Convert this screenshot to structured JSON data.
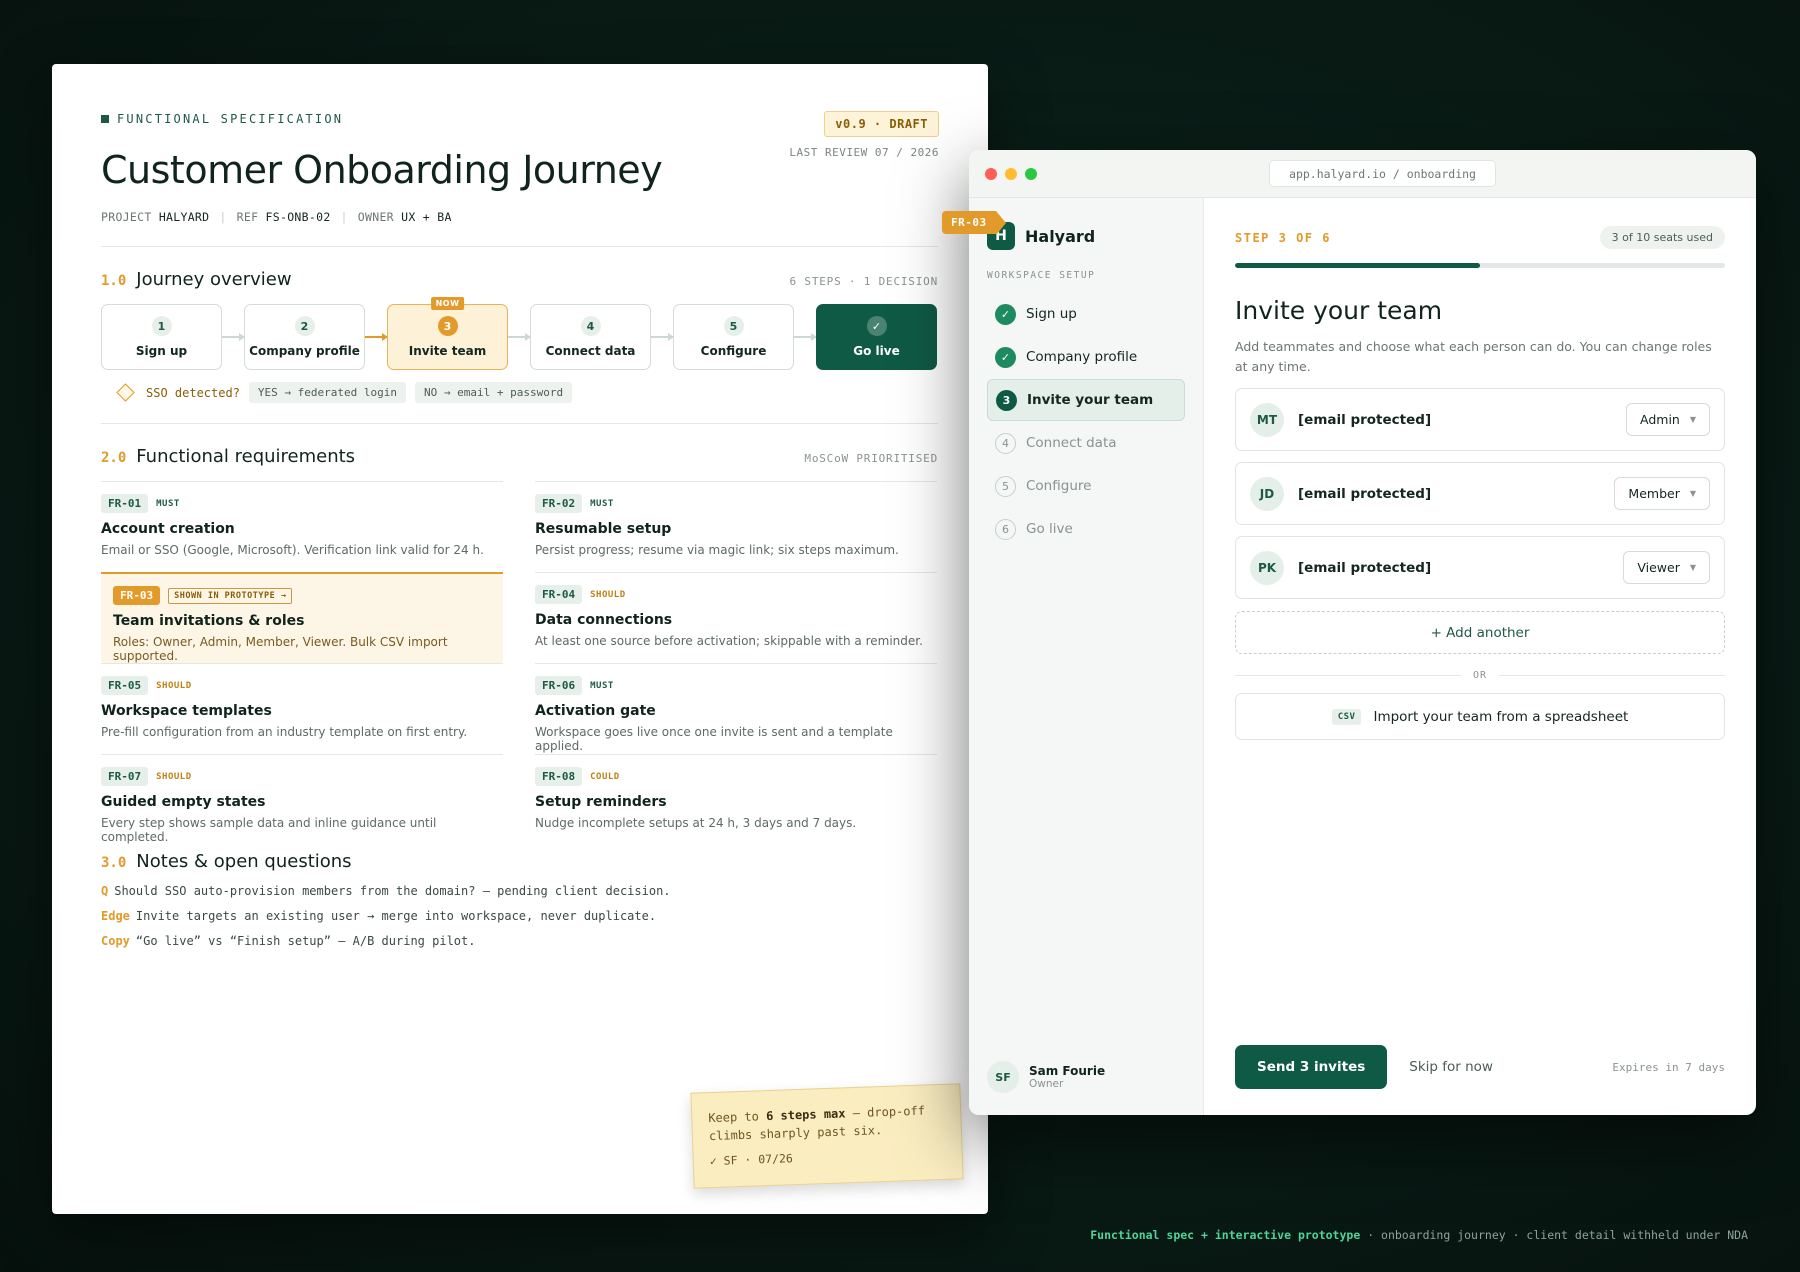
{
  "spec": {
    "eyebrow": "FUNCTIONAL SPECIFICATION",
    "version": "v0.9 · DRAFT",
    "last_review": "LAST REVIEW 07 / 2026",
    "title": "Customer Onboarding Journey",
    "meta": {
      "project_label": "PROJECT",
      "project_value": "HALYARD",
      "ref_label": "REF",
      "ref_value": "FS-ONB-02",
      "owner_label": "OWNER",
      "owner_value": "UX + BA"
    },
    "overview": {
      "num": "1.0",
      "title": "Journey overview",
      "summary": "6 STEPS · 1 DECISION",
      "now_label": "NOW",
      "steps": [
        {
          "marker": "1",
          "label": "Sign up"
        },
        {
          "marker": "2",
          "label": "Company profile"
        },
        {
          "marker": "3",
          "label": "Invite team"
        },
        {
          "marker": "4",
          "label": "Connect data"
        },
        {
          "marker": "5",
          "label": "Configure"
        },
        {
          "marker": "✓",
          "label": "Go live"
        }
      ],
      "decision": {
        "question": "SSO detected?",
        "yes": "YES → federated login",
        "no": "NO → email + password"
      }
    },
    "requirements": {
      "num": "2.0",
      "title": "Functional requirements",
      "summary": "MoSCoW PRIORITISED",
      "prototype_tag": "SHOWN IN PROTOTYPE →",
      "items": [
        {
          "id": "FR-01",
          "priority": "MUST",
          "title": "Account creation",
          "desc": "Email or SSO (Google, Microsoft). Verification link valid for 24 h."
        },
        {
          "id": "FR-02",
          "priority": "MUST",
          "title": "Resumable setup",
          "desc": "Persist progress; resume via magic link; six steps maximum."
        },
        {
          "id": "FR-03",
          "priority": "",
          "title": "Team invitations & roles",
          "desc": "Roles: Owner, Admin, Member, Viewer. Bulk CSV import supported."
        },
        {
          "id": "FR-04",
          "priority": "SHOULD",
          "title": "Data connections",
          "desc": "At least one source before activation; skippable with a reminder."
        },
        {
          "id": "FR-05",
          "priority": "SHOULD",
          "title": "Workspace templates",
          "desc": "Pre-fill configuration from an industry template on first entry."
        },
        {
          "id": "FR-06",
          "priority": "MUST",
          "title": "Activation gate",
          "desc": "Workspace goes live once one invite is sent and a template applied."
        },
        {
          "id": "FR-07",
          "priority": "SHOULD",
          "title": "Guided empty states",
          "desc": "Every step shows sample data and inline guidance until completed."
        },
        {
          "id": "FR-08",
          "priority": "COULD",
          "title": "Setup reminders",
          "desc": "Nudge incomplete setups at 24 h, 3 days and 7 days."
        }
      ]
    },
    "notes": {
      "num": "3.0",
      "title": "Notes & open questions",
      "items": [
        {
          "key": "Q",
          "text": "Should SSO auto-provision members from the domain? — pending client decision."
        },
        {
          "key": "Edge",
          "text": "Invite targets an existing user → merge into workspace, never duplicate."
        },
        {
          "key": "Copy",
          "text": "“Go live” vs “Finish setup” — A/B during pilot."
        }
      ]
    },
    "sticky": {
      "pre": "Keep to ",
      "bold": "6 steps max",
      "post": " — drop-off climbs sharply past six.",
      "signature": "✓ SF · 07/26"
    }
  },
  "callout": "FR-03",
  "prototype": {
    "url": "app.halyard.io / onboarding",
    "brand": {
      "logo": "H",
      "name": "Halyard"
    },
    "sidebar_caption": "WORKSPACE SETUP",
    "nav": [
      {
        "marker": "✓",
        "label": "Sign up",
        "state": "done"
      },
      {
        "marker": "✓",
        "label": "Company profile",
        "state": "done"
      },
      {
        "marker": "3",
        "label": "Invite your team",
        "state": "cur"
      },
      {
        "marker": "4",
        "label": "Connect data",
        "state": "todo"
      },
      {
        "marker": "5",
        "label": "Configure",
        "state": "todo"
      },
      {
        "marker": "6",
        "label": "Go live",
        "state": "todo"
      }
    ],
    "user": {
      "initials": "SF",
      "name": "Sam Fourie",
      "role": "Owner"
    },
    "step_label": "STEP 3 OF 6",
    "seats": "3 of 10 seats used",
    "progress": 0.5,
    "heading": "Invite your team",
    "subtext": "Add teammates and choose what each person can do. You can change roles at any time.",
    "invites": [
      {
        "initials": "MT",
        "email": "[email protected]",
        "role": "Admin"
      },
      {
        "initials": "JD",
        "email": "[email protected]",
        "role": "Member"
      },
      {
        "initials": "PK",
        "email": "[email protected]",
        "role": "Viewer"
      }
    ],
    "add_another": "+ Add another",
    "or": "OR",
    "csv_tag": "CSV",
    "csv_label": "Import your team from a spreadsheet",
    "send": "Send 3 invites",
    "skip": "Skip for now",
    "expires": "Expires in 7 days"
  },
  "caption": {
    "highlight": "Functional spec + interactive prototype",
    "rest": " · onboarding journey · client detail withheld under NDA"
  },
  "colors": {
    "accent": "#e29a2b",
    "brand": "#0f5a44",
    "done": "#1e8a60"
  }
}
